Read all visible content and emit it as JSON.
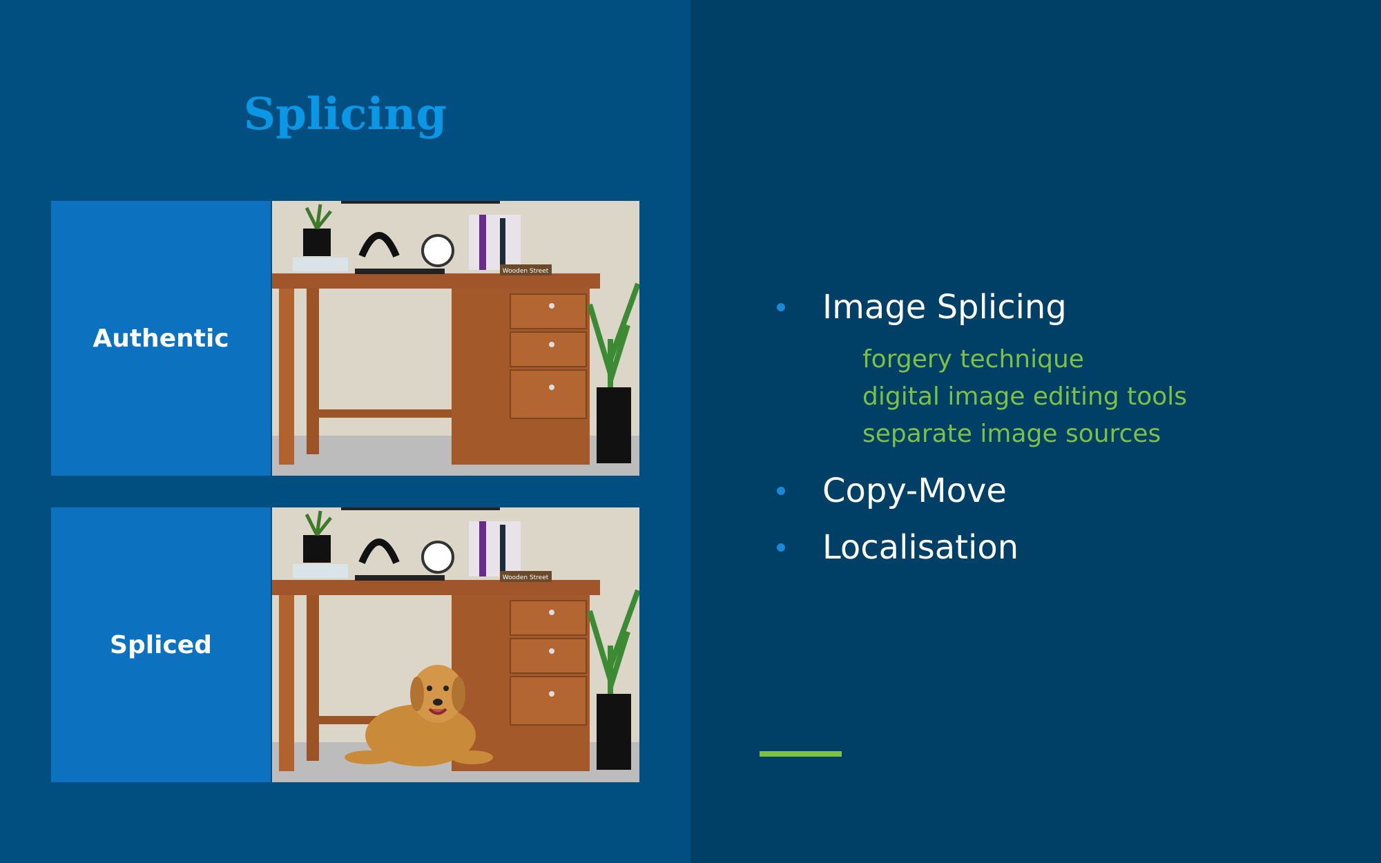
{
  "slide": {
    "title": "Splicing",
    "examples": [
      {
        "label": "Authentic"
      },
      {
        "label": "Spliced"
      }
    ],
    "desk_sign": "Wooden Street",
    "bullets": [
      {
        "text": "Image Splicing",
        "sub": [
          "forgery technique",
          "digital image editing tools",
          "separate image sources"
        ]
      },
      {
        "text": "Copy-Move"
      },
      {
        "text": "Localisation"
      }
    ]
  },
  "colors": {
    "left_background": "#004f80",
    "right_background": "#003f66",
    "title": "#0a98e6",
    "label_box": "#0c72bf",
    "bullet_dot": "#1a88d8",
    "sub_text": "#7cc142",
    "accent": "#7cc142"
  }
}
